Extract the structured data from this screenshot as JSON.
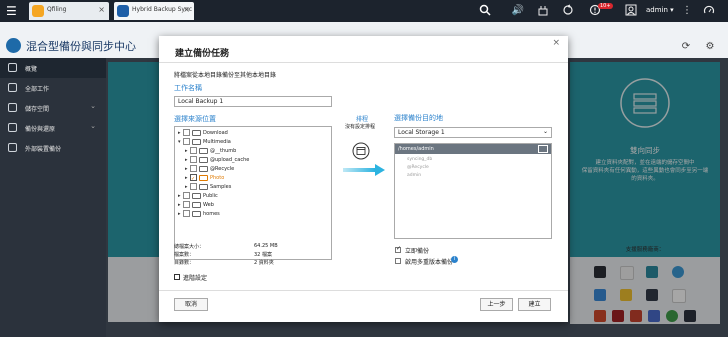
{
  "topbar": {
    "tabs": [
      {
        "label": "Qfiling",
        "color": "#f5a623"
      },
      {
        "label": "Hybrid Backup Sync",
        "color": "#1e5fa8"
      }
    ],
    "notification_count": "10+",
    "user": "admin ▾"
  },
  "app": {
    "title": "混合型備份與同步中心"
  },
  "sidebar": {
    "items": [
      {
        "label": "概覽"
      },
      {
        "label": "全部工作"
      },
      {
        "label": "儲存空間"
      },
      {
        "label": "備份與還原"
      },
      {
        "label": "外部裝置備份"
      }
    ]
  },
  "right_card": {
    "title": "雙向同步",
    "desc_line1": "建立資料夾配對，並在遠端的儲存空間中",
    "desc_line2": "保留資料夾有任何異動，這些異動也會同步至另一端",
    "desc_line3": "的資料夾。",
    "support_label": "支援服務廠商："
  },
  "modal": {
    "title": "建立備份任務",
    "description": "將檔案從本地目錄備份至其他本地目錄",
    "job_name_label": "工作名稱",
    "job_name_value": "Local Backup 1",
    "source_label": "選擇來源位置",
    "tree": [
      {
        "label": "Download",
        "level": 0,
        "checked": false,
        "expanded": false,
        "highlight": false
      },
      {
        "label": "Multimedia",
        "level": 0,
        "checked": false,
        "expanded": true,
        "highlight": false
      },
      {
        "label": "@__thumb",
        "level": 1,
        "checked": false,
        "expanded": false,
        "highlight": false
      },
      {
        "label": "@upload_cache",
        "level": 1,
        "checked": false,
        "expanded": false,
        "highlight": false
      },
      {
        "label": "@Recycle",
        "level": 1,
        "checked": false,
        "expanded": false,
        "highlight": false
      },
      {
        "label": "Photo",
        "level": 1,
        "checked": true,
        "expanded": false,
        "highlight": true
      },
      {
        "label": "Samples",
        "level": 1,
        "checked": false,
        "expanded": false,
        "highlight": false
      },
      {
        "label": "Public",
        "level": 0,
        "checked": false,
        "expanded": false,
        "highlight": false
      },
      {
        "label": "Web",
        "level": 0,
        "checked": false,
        "expanded": false,
        "highlight": false
      },
      {
        "label": "homes",
        "level": 0,
        "checked": false,
        "expanded": false,
        "highlight": false
      }
    ],
    "stats": [
      {
        "label": "總檔案大小：",
        "value": "64.25 MB"
      },
      {
        "label": "檔案數：",
        "value": "32 檔案"
      },
      {
        "label": "目錄數：",
        "value": "2 資料夾"
      }
    ],
    "advanced_label": "進階設定",
    "schedule_label": "排程",
    "schedule_sub": "沒有設定排程",
    "dest_label": "選擇備份目的地",
    "dest_select": "Local Storage 1",
    "dest_path": "/homes/admin",
    "dest_tree": [
      {
        "label": "syncing_db"
      },
      {
        "label": "@Recycle"
      },
      {
        "label": "admin"
      }
    ],
    "opt_backup_now": "立即備份",
    "opt_multi_version": "啟用多重版本備份",
    "btn_cancel": "取消",
    "btn_prev": "上一步",
    "btn_create": "建立"
  }
}
